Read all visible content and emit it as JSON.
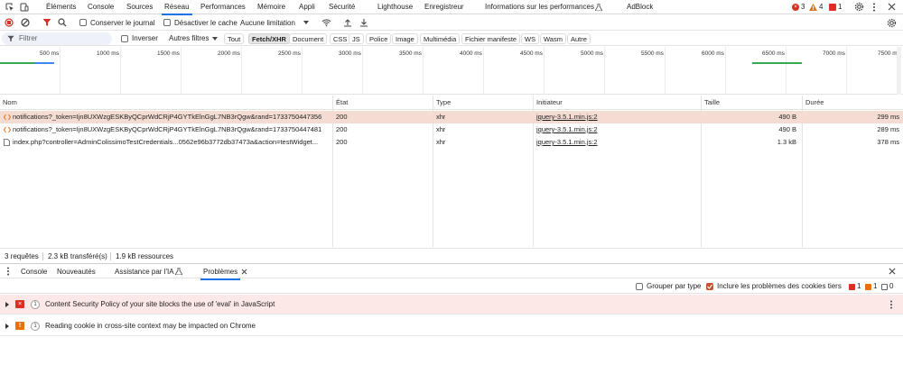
{
  "tabs": [
    "Éléments",
    "Console",
    "Sources",
    "Réseau",
    "Performances",
    "Mémoire",
    "Appli",
    "Sécurité",
    "Lighthouse",
    "Enregistreur",
    "Informations sur les performances",
    "AdBlock"
  ],
  "tab_active": "Réseau",
  "tab_counts": {
    "errors": "3",
    "warnings": "4",
    "info": "1"
  },
  "toolbar": {
    "preserve_log": "Conserver le journal",
    "disable_cache": "Désactiver le cache",
    "throttling": "Aucune limitation"
  },
  "filter": {
    "placeholder": "Filtrer",
    "invert": "Inverser",
    "more_filters": "Autres filtres",
    "chips": [
      "Tout",
      "Fetch/XHR",
      "Document",
      "CSS",
      "JS",
      "Police",
      "Image",
      "Multimédia",
      "Fichier manifeste",
      "WS",
      "Wasm",
      "Autre"
    ],
    "active_chip": "Fetch/XHR"
  },
  "timeline": {
    "ticks": [
      "500 ms",
      "1000 ms",
      "1500 ms",
      "2000 ms",
      "2500 ms",
      "3000 ms",
      "3500 ms",
      "4000 ms",
      "4500 ms",
      "5000 ms",
      "5500 ms",
      "6000 ms",
      "6500 ms",
      "7000 ms",
      "7500 ms"
    ]
  },
  "table": {
    "columns": [
      "Nom",
      "État",
      "Type",
      "Initiateur",
      "Taille",
      "Durée"
    ],
    "rows": [
      {
        "name": "notifications?_token=Ijn8UXWzgESKByQCprWdCRjP4GYTkElnGgL7NB3rQgw&rand=1733750447356",
        "status": "200",
        "type": "xhr",
        "initiator": "jquery-3.5.1.min.js:2",
        "size": "490 B",
        "time": "299 ms"
      },
      {
        "name": "notifications?_token=Ijn8UXWzgESKByQCprWdCRjP4GYTkElnGgL7NB3rQgw&rand=1733750447481",
        "status": "200",
        "type": "xhr",
        "initiator": "jquery-3.5.1.min.js:2",
        "size": "490 B",
        "time": "289 ms"
      },
      {
        "name": "index.php?controller=AdminColissimoTestCredentials...0562e96b3772db37473a&action=testWidget...",
        "status": "200",
        "type": "xhr",
        "initiator": "jquery-3.5.1.min.js:2",
        "size": "1.3 kB",
        "time": "378 ms"
      }
    ]
  },
  "status": {
    "requests": "3 requêtes",
    "transferred": "2.3 kB transféré(s)",
    "resources": "1.9 kB ressources"
  },
  "drawer": {
    "tabs": [
      "Console",
      "Nouveautés",
      "Assistance par l'IA",
      "Problèmes"
    ],
    "active": "Problèmes"
  },
  "issues_toolbar": {
    "group_by_type": "Grouper par type",
    "include_third_party": "Inclure les problèmes des cookies tiers",
    "counts": {
      "errors": "1",
      "warnings": "1",
      "info": "0"
    }
  },
  "issues": [
    {
      "count": "1",
      "text": "Content Security Policy of your site blocks the use of 'eval' in JavaScript",
      "kind": "error"
    },
    {
      "count": "1",
      "text": "Reading cookie in cross-site context may be impacted on Chrome",
      "kind": "warning"
    }
  ],
  "colors": {
    "accent": "#1a73e8",
    "error": "#d93025",
    "warning": "#e8710a",
    "selected_row": "#f4dcd3"
  }
}
